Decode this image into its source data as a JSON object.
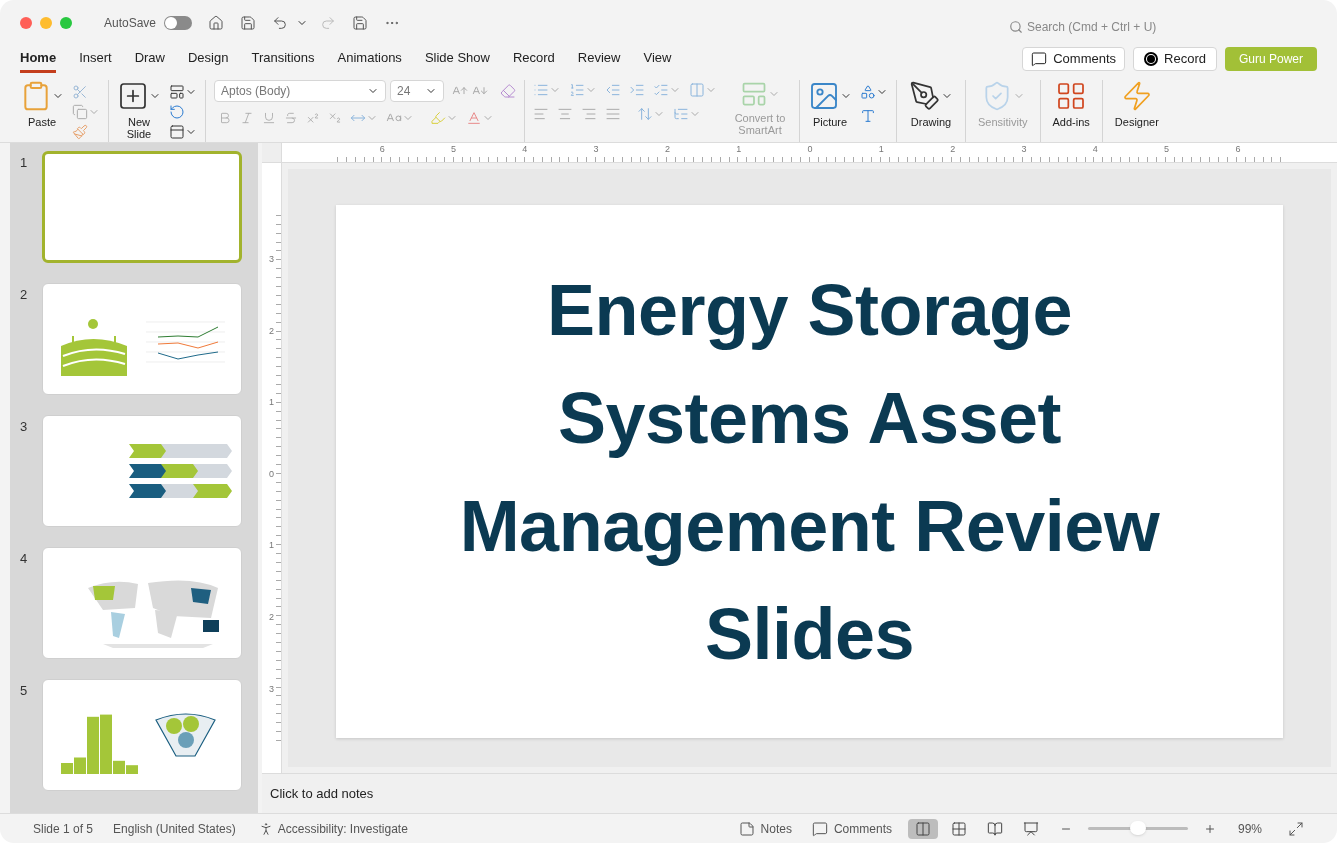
{
  "window": {
    "autosave": {
      "label": "AutoSave",
      "on": false
    },
    "search": {
      "placeholder": "Search (Cmd + Ctrl + U)"
    }
  },
  "tabs": [
    {
      "label": "Home",
      "selected": true
    },
    {
      "label": "Insert",
      "selected": false
    },
    {
      "label": "Draw",
      "selected": false
    },
    {
      "label": "Design",
      "selected": false
    },
    {
      "label": "Transitions",
      "selected": false
    },
    {
      "label": "Animations",
      "selected": false
    },
    {
      "label": "Slide Show",
      "selected": false
    },
    {
      "label": "Record",
      "selected": false
    },
    {
      "label": "Review",
      "selected": false
    },
    {
      "label": "View",
      "selected": false
    }
  ],
  "actions": [
    {
      "kind": "comments",
      "label": "Comments"
    },
    {
      "kind": "record",
      "label": "Record"
    },
    {
      "kind": "brand",
      "label": "Guru Power"
    }
  ],
  "ribbon_groups": [
    {
      "kind": "clipboard",
      "label": "Paste",
      "disabled": false
    },
    {
      "kind": "slides",
      "label": "New Slide",
      "disabled": false
    },
    {
      "kind": "font",
      "font": "Aptos (Body)",
      "size": "24",
      "disabled": false
    },
    {
      "kind": "paragraph",
      "label": "Convert to SmartArt",
      "disabled": true
    },
    {
      "kind": "insert",
      "label": "Picture",
      "disabled": false
    },
    {
      "kind": "drawing",
      "label": "Drawing",
      "disabled": false
    },
    {
      "kind": "sensitivity",
      "label": "Sensitivity",
      "disabled": true
    },
    {
      "kind": "addins",
      "label": "Add-ins",
      "disabled": false
    },
    {
      "kind": "designer",
      "label": "Designer",
      "disabled": false
    }
  ],
  "thumbnails": [
    {
      "number": "1",
      "kind": "blank",
      "selected": true
    },
    {
      "number": "2",
      "kind": "landscape-chart",
      "selected": false
    },
    {
      "number": "3",
      "kind": "chevrons",
      "selected": false
    },
    {
      "number": "4",
      "kind": "world-map",
      "selected": false
    },
    {
      "number": "5",
      "kind": "histogram-funnel",
      "selected": false
    }
  ],
  "rulers": {
    "horizontal": [
      "6",
      "5",
      "4",
      "3",
      "2",
      "1",
      "0",
      "1",
      "2",
      "3",
      "4",
      "5",
      "6"
    ],
    "vertical": [
      "3",
      "2",
      "1",
      "0",
      "1",
      "2",
      "3"
    ]
  },
  "slide": {
    "title": "Energy Storage Systems Asset Management Review Slides"
  },
  "notes": {
    "placeholder": "Click to add notes"
  },
  "status_bar": {
    "slide": "Slide 1 of 5",
    "language": "English (United States)",
    "accessibility": "Accessibility: Investigate",
    "notes": "Notes",
    "comments": "Comments",
    "views": [
      {
        "kind": "normal",
        "selected": true
      },
      {
        "kind": "sorter",
        "selected": false
      },
      {
        "kind": "reading",
        "selected": false
      },
      {
        "kind": "slideshow",
        "selected": false
      }
    ],
    "zoom": {
      "level": 0.5,
      "reading": "99%"
    }
  }
}
